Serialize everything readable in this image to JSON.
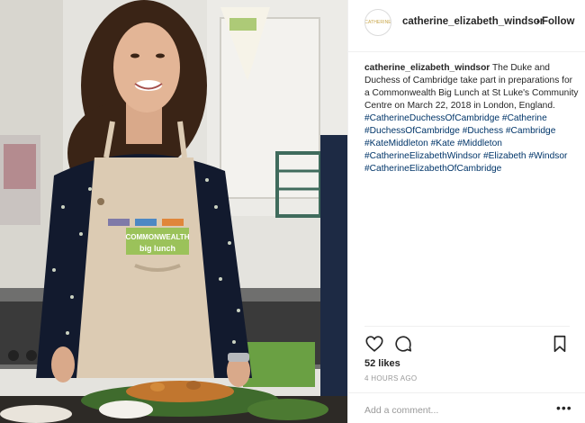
{
  "post": {
    "username": "catherine_elizabeth_windsor",
    "avatar_text": "CATHERINE",
    "follow_label": "Follow",
    "separator": "•",
    "caption": {
      "username": "catherine_elizabeth_windsor",
      "text": "The Duke and Duchess of Cambridge take part in preparations for a Commonwealth Big Lunch at St Luke's Community Centre on March 22, 2018 in London, England.",
      "hashtags": [
        "#CatherineDuchessOfCambridge",
        "#Catherine",
        "#DuchessOfCambridge",
        "#Duchess",
        "#Cambridge",
        "#KateMiddleton",
        "#Kate",
        "#Middleton",
        "#CatherineElizabethWindsor",
        "#Elizabeth",
        "#Windsor",
        "#CatherineElizabethOfCambridge"
      ]
    },
    "apron_text": {
      "line1": "COMMONWEALTH",
      "line2": "big lunch"
    },
    "likes": "52 likes",
    "timestamp": "4 HOURS AGO",
    "comment_placeholder": "Add a comment...",
    "more_label": "•••"
  },
  "icons": [
    "heart-icon",
    "comment-icon",
    "bookmark-icon"
  ],
  "colors": {
    "text": "#262626",
    "hashtag": "#003569",
    "muted": "#999999",
    "border": "#efefef"
  }
}
